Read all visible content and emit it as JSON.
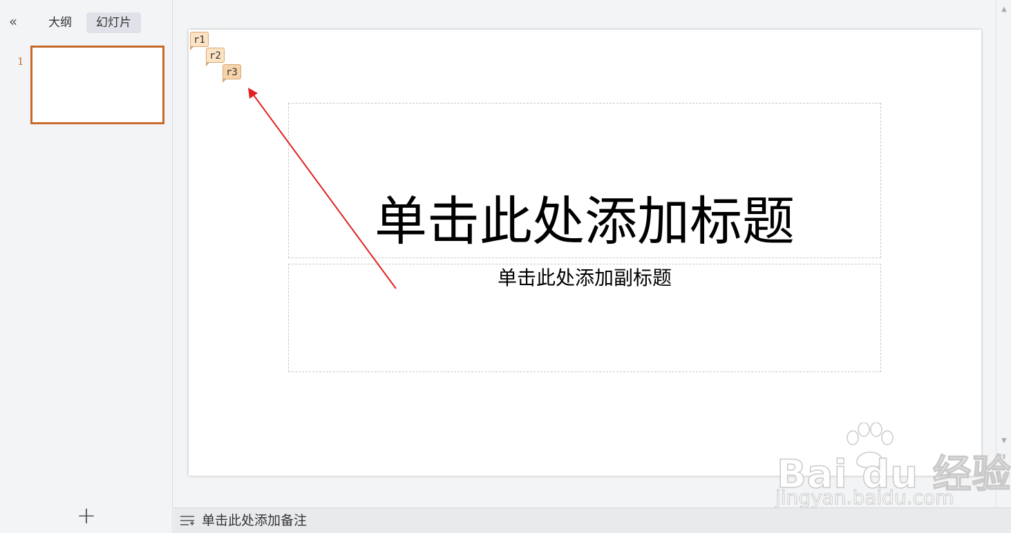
{
  "sidebar": {
    "collapse_glyph": "«",
    "tabs": [
      {
        "label": "大纲",
        "active": false
      },
      {
        "label": "幻灯片",
        "active": true
      }
    ],
    "thumbnails": [
      {
        "number": "1",
        "selected": true
      }
    ],
    "add_glyph": "+"
  },
  "slide": {
    "title_placeholder": "单击此处添加标题",
    "subtitle_placeholder": "单击此处添加副标题",
    "comment_tags": [
      "r1",
      "r2",
      "r3"
    ]
  },
  "notes": {
    "placeholder": "单击此处添加备注"
  },
  "watermark": {
    "brand": "Bai du 经验",
    "url": "jingyan.baidu.com"
  },
  "colors": {
    "accent": "#c8692b",
    "annotation_arrow": "#e02020",
    "comment_tag_bg": "#fbe3c4"
  },
  "icons": {
    "collapse": "double-chevron-left-icon",
    "add": "plus-icon",
    "notes": "notes-lines-icon"
  }
}
